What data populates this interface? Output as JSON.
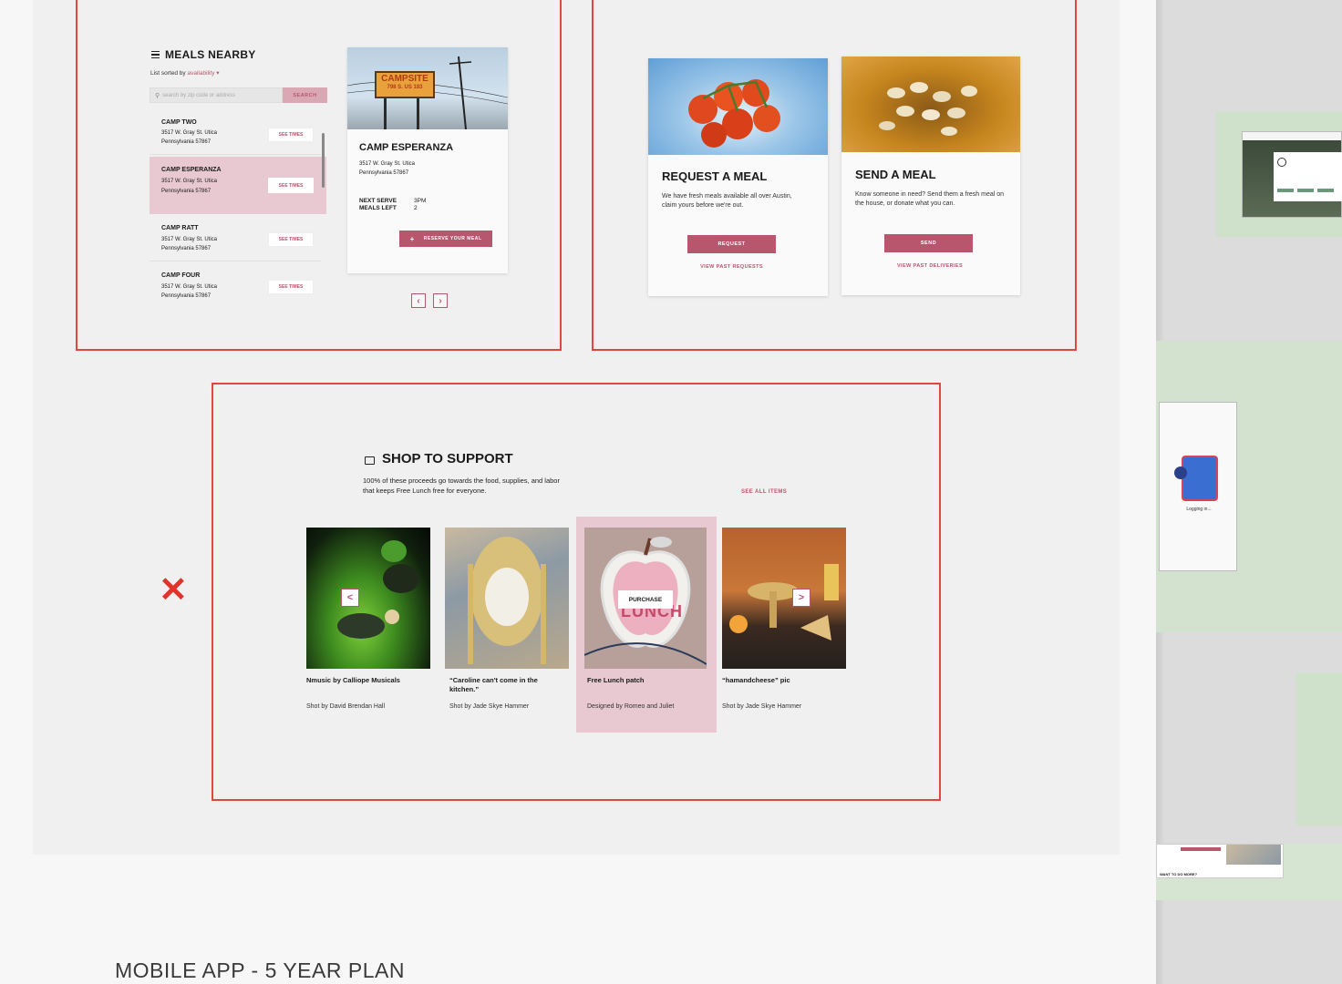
{
  "meals": {
    "title": "MEALS NEARBY",
    "sort_prefix": "List sorted by",
    "sort_value": "availability",
    "search_placeholder": "search by zip code or address",
    "search_button": "SEARCH",
    "see_times": "SEE TIMES",
    "camps": [
      {
        "name": "CAMP TWO",
        "line1": "3517 W. Gray St. Utica",
        "line2": "Pennsylvania 57867"
      },
      {
        "name": "CAMP ESPERANZA",
        "line1": "3517 W. Gray St. Utica",
        "line2": "Pennsylvania 57867"
      },
      {
        "name": "CAMP RATT",
        "line1": "3517 W. Gray St. Utica",
        "line2": "Pennsylvania 57867"
      },
      {
        "name": "CAMP FOUR",
        "line1": "3517 W. Gray St. Utica",
        "line2": "Pennsylvania 57867"
      }
    ],
    "sign_line1": "CAMPSITE",
    "sign_line2": "798 S. US 183",
    "detail": {
      "title": "CAMP ESPERANZA",
      "line1": "3517 W. Gray St. Utica",
      "line2": "Pennsylvania 57867",
      "next_serve_label": "NEXT SERVE",
      "next_serve_value": "3PM",
      "meals_left_label": "MEALS LEFT",
      "meals_left_value": "2",
      "reserve_button": "RESERVE YOUR MEAL"
    }
  },
  "request": {
    "title": "REQUEST A MEAL",
    "text": "We have fresh meals available all over Austin, claim yours before we're out.",
    "button": "REQUEST",
    "link": "VIEW PAST REQUESTS"
  },
  "send": {
    "title": "SEND A MEAL",
    "text": "Know someone in need? Send them a fresh meal on the house, or donate what you can.",
    "button": "SEND",
    "link": "VIEW PAST DELIVERIES"
  },
  "shop": {
    "title": "SHOP TO SUPPORT",
    "text": "100% of these proceeds go towards the food, supplies, and labor that keeps Free Lunch free for everyone.",
    "see_all": "SEE ALL ITEMS",
    "purchase": "PURCHASE",
    "patch_text": "LUNCH",
    "items": [
      {
        "title": "Nmusic by Calliope Musicals",
        "credit": "Shot by David Brendan Hall"
      },
      {
        "title": "“Caroline can't come in the kitchen.”",
        "credit": "Shot by Jade Skye Hammer"
      },
      {
        "title": "Free Lunch patch",
        "credit": "Designed by Romeo and Juliet"
      },
      {
        "title": "“hamandcheese” pic",
        "credit": "Shot by Jade Skye Hammer"
      }
    ]
  },
  "reject_mark": "✕",
  "section_title": "MOBILE APP - 5 YEAR PLAN",
  "thumbnails": {
    "logging_in": "Logging in...",
    "want_more": "WANT TO DO MORE?"
  },
  "colors": {
    "accent": "#b8566d",
    "frame": "#e0483d",
    "highlight": "#e8c9d1"
  }
}
